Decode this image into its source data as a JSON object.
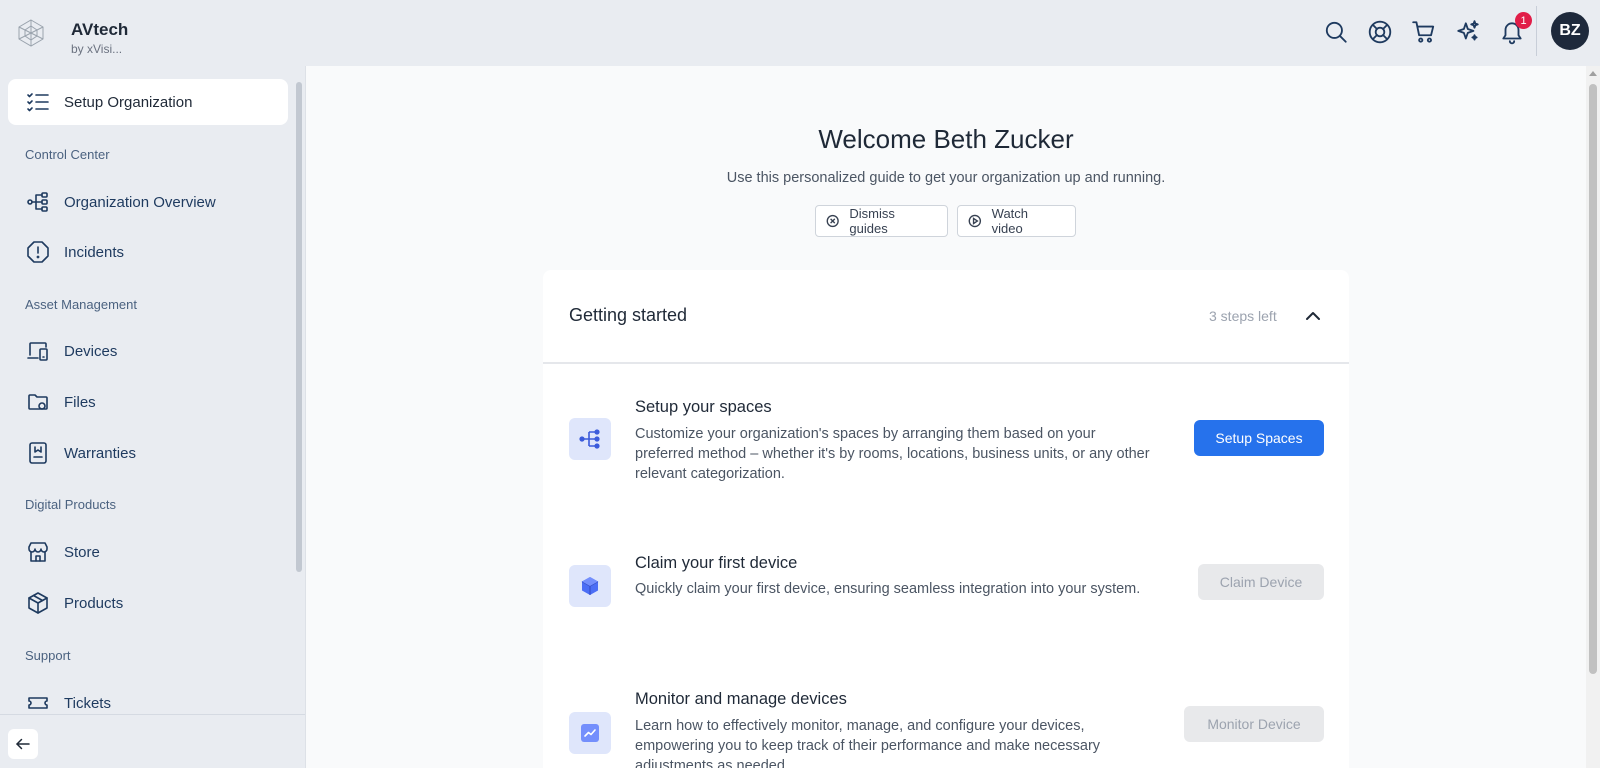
{
  "brand": {
    "name": "AVtech",
    "subtitle": "by xVisi..."
  },
  "topbar": {
    "notification_count": "1",
    "avatar_initials": "BZ"
  },
  "sidebar": {
    "active_item": {
      "label": "Setup Organization",
      "icon": "checklist-icon"
    },
    "sections": [
      {
        "title": "Control Center",
        "items": [
          {
            "label": "Organization Overview",
            "icon": "hierarchy-icon"
          },
          {
            "label": "Incidents",
            "icon": "alert-shield-icon"
          }
        ]
      },
      {
        "title": "Asset Management",
        "items": [
          {
            "label": "Devices",
            "icon": "devices-icon"
          },
          {
            "label": "Files",
            "icon": "folder-icon"
          },
          {
            "label": "Warranties",
            "icon": "warranty-icon"
          }
        ]
      },
      {
        "title": "Digital Products",
        "items": [
          {
            "label": "Store",
            "icon": "store-icon"
          },
          {
            "label": "Products",
            "icon": "box-icon"
          }
        ]
      },
      {
        "title": "Support",
        "items": [
          {
            "label": "Tickets",
            "icon": "ticket-icon"
          }
        ]
      }
    ]
  },
  "welcome": {
    "title": "Welcome Beth Zucker",
    "subtitle": "Use this personalized guide to get your organization up and running.",
    "dismiss_label": "Dismiss guides",
    "video_label": "Watch video"
  },
  "getting_started": {
    "title": "Getting started",
    "steps_left": "3 steps left",
    "steps": [
      {
        "title": "Setup your spaces",
        "description": "Customize your organization's spaces by arranging them based on your preferred method – whether it's by rooms, locations, business units, or any other relevant categorization.",
        "button": "Setup Spaces",
        "button_state": "primary"
      },
      {
        "title": "Claim your first device",
        "description": "Quickly claim your first device, ensuring seamless integration into your system.",
        "button": "Claim Device",
        "button_state": "disabled"
      },
      {
        "title": "Monitor and manage devices",
        "description": "Learn how to effectively monitor, manage, and configure your devices, empowering you to keep track of their performance and make necessary adjustments as needed.",
        "button": "Monitor Device",
        "button_state": "disabled"
      }
    ]
  },
  "colors": {
    "primary": "#2672ec",
    "sidebar_bg": "#e9ecf1",
    "icon_navy": "#1e3a5f",
    "badge_red": "#e11d48"
  }
}
